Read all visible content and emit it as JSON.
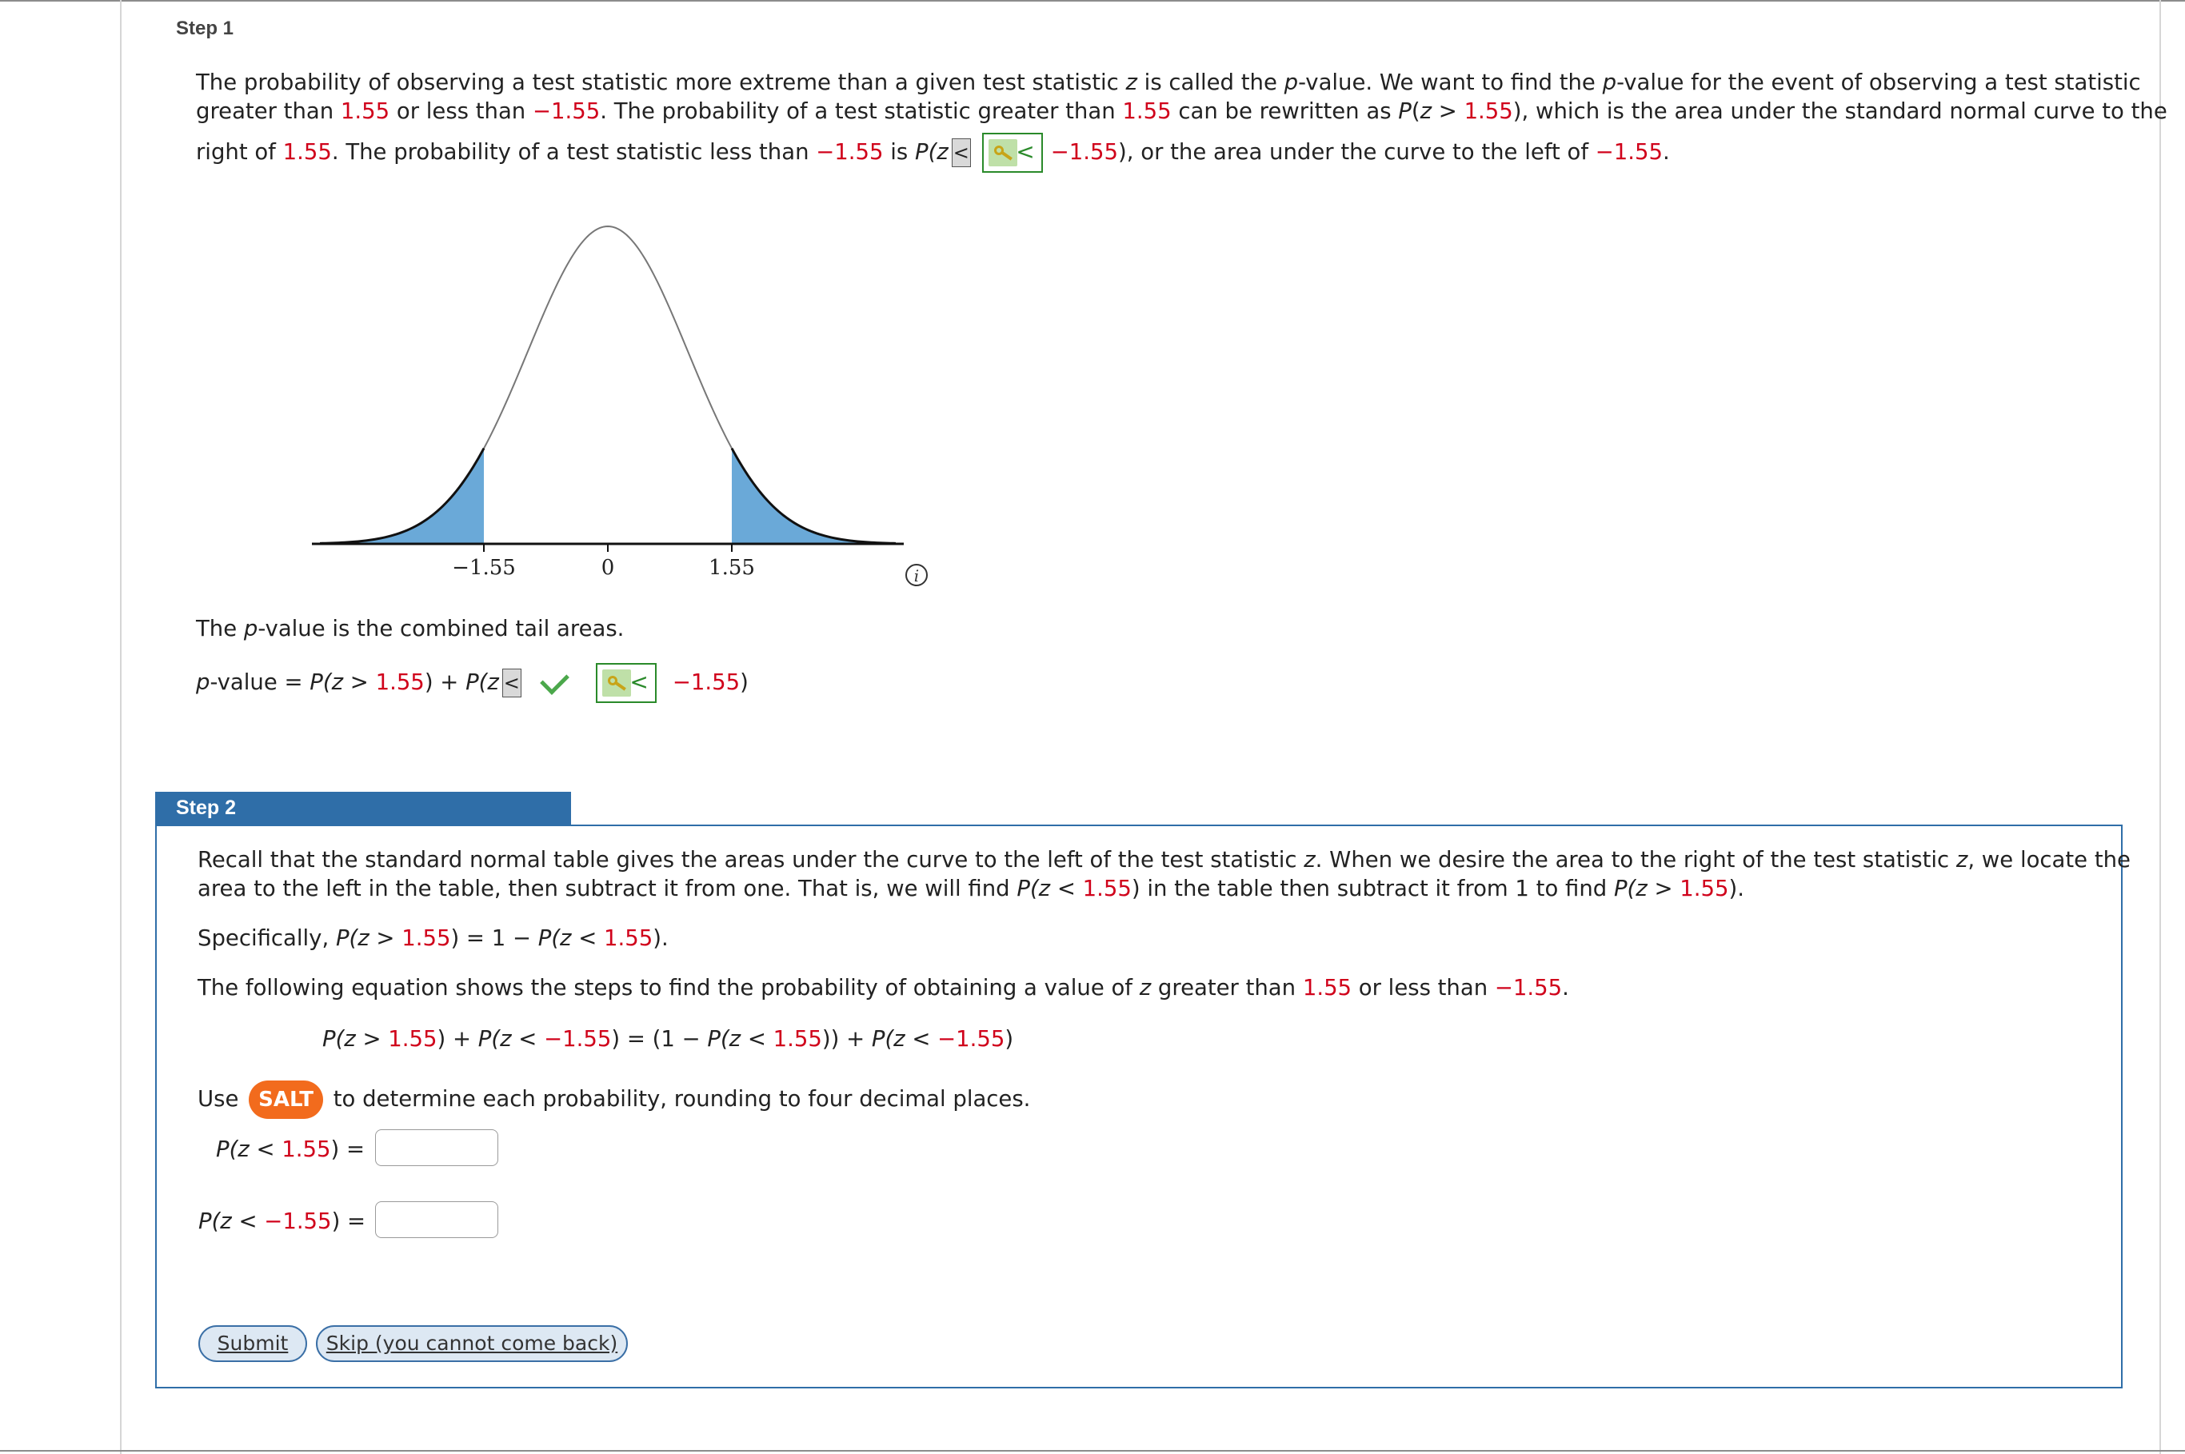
{
  "step1": {
    "heading": "Step 1",
    "line1_a": "The probability of observing a test statistic more extreme than a given test statistic ",
    "line1_z": "z",
    "line1_b": " is called the ",
    "line1_p1": "p",
    "line1_c": "-value. We want to find the ",
    "line1_p2": "p",
    "line1_d": "-value for the event of observing a test statistic",
    "line2_a": "greater than ",
    "line2_v1": "1.55",
    "line2_b": " or less than ",
    "line2_v2": "−1.55",
    "line2_c": ". The probability of a test statistic greater than ",
    "line2_v3": "1.55",
    "line2_d": " can be rewritten as ",
    "line2_p": "P",
    "line2_e": "(",
    "line2_z": "z",
    "line2_f": " > ",
    "line2_v4": "1.55",
    "line2_g": "), which is the area under the standard normal curve to the",
    "line3_a": "right of ",
    "line3_v1": "1.55",
    "line3_b": ". The probability of a test statistic less than ",
    "line3_v2": "−1.55",
    "line3_c": " is ",
    "line3_p": "P(z",
    "line3_sel": "<",
    "line3_key": "<",
    "line3_v3": "−1.55",
    "line3_d": "), or the area under the curve to the left of ",
    "line3_v4": "−1.55",
    "line3_e": ".",
    "pvalue_note_a": "The ",
    "pvalue_note_p": "p",
    "pvalue_note_b": "-value is the combined tail areas.",
    "eq_p": "p",
    "eq_a": "-value = ",
    "eq_b": "P(z > ",
    "eq_v1": "1.55",
    "eq_c": ") + ",
    "eq_d": "P(z",
    "eq_sel": "<",
    "eq_key": "<",
    "eq_v2": "−1.55",
    "eq_e": ")"
  },
  "chart_data": {
    "type": "area",
    "distribution": "standard normal",
    "x_ticks": [
      "−1.55",
      "0",
      "1.55"
    ],
    "shaded_regions": [
      {
        "from": "-inf",
        "to": -1.55
      },
      {
        "from": 1.55,
        "to": "inf"
      }
    ],
    "xlim": [
      -3.6,
      3.6
    ],
    "shade_color": "#6aa9d8",
    "info_icon": "info-icon"
  },
  "step2": {
    "heading": "Step 2",
    "p1_a": "Recall that the standard normal table gives the areas under the curve to the left of the test statistic ",
    "p1_z1": "z",
    "p1_b": ". When we desire the area to the right of the test statistic ",
    "p1_z2": "z",
    "p1_c": ", we locate the",
    "p2_a": "area to the left in the table, then subtract it from one. That is, we will find ",
    "p2_b": "P(z < ",
    "p2_v1": "1.55",
    "p2_c": ") in the table then subtract it from 1 to find ",
    "p2_d": "P(z > ",
    "p2_v2": "1.55",
    "p2_e": ").",
    "spec_a": "Specifically, ",
    "spec_b": "P(z > ",
    "spec_v1": "1.55",
    "spec_c": ") = 1 − ",
    "spec_d": "P(z < ",
    "spec_v2": "1.55",
    "spec_e": ").",
    "follow_a": "The following equation shows the steps to find the probability of obtaining a value of ",
    "follow_z": "z",
    "follow_b": " greater than ",
    "follow_v1": "1.55",
    "follow_c": " or less than ",
    "follow_v2": "−1.55",
    "follow_d": ".",
    "eq_a": "P(z > ",
    "eq_v1": "1.55",
    "eq_b": ") + ",
    "eq_c": "P(z < ",
    "eq_v2": "−1.55",
    "eq_d": ") = (1 − ",
    "eq_e": "P(z < ",
    "eq_v3": "1.55",
    "eq_f": ")) + ",
    "eq_g": "P(z < ",
    "eq_v4": "−1.55",
    "eq_h": ")",
    "use_a": "Use ",
    "salt": "SALT",
    "use_b": " to determine each probability, rounding to four decimal places.",
    "q1_a": "P(z < ",
    "q1_v": "1.55",
    "q1_b": ")  =",
    "q2_a": "P(z < ",
    "q2_v": "−1.55",
    "q2_b": ")  =",
    "q1_value": "",
    "q2_value": "",
    "submit_label": "Submit",
    "skip_label": "Skip (you cannot come back)"
  },
  "colors": {
    "highlight": "#d0021b",
    "step2_accent": "#2f6ea8",
    "salt": "#f26b1d"
  }
}
